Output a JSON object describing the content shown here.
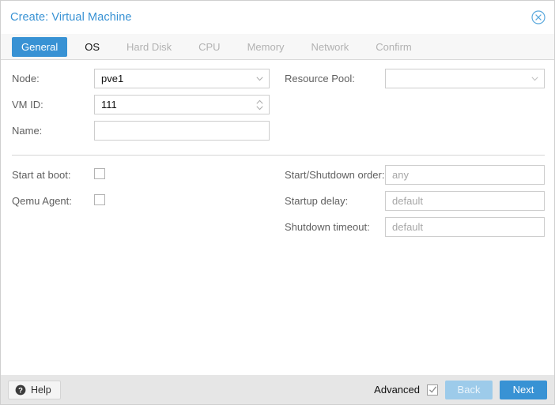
{
  "window": {
    "title": "Create: Virtual Machine",
    "close_icon": "circle-x-icon",
    "accent_color": "#3892d4",
    "disabled_accent_color": "#9dcbea"
  },
  "tabs": [
    {
      "label": "General",
      "state": "active"
    },
    {
      "label": "OS",
      "state": "enabled"
    },
    {
      "label": "Hard Disk",
      "state": "disabled"
    },
    {
      "label": "CPU",
      "state": "disabled"
    },
    {
      "label": "Memory",
      "state": "disabled"
    },
    {
      "label": "Network",
      "state": "disabled"
    },
    {
      "label": "Confirm",
      "state": "disabled"
    }
  ],
  "form": {
    "left": {
      "node": {
        "label": "Node:",
        "value": "pve1",
        "type": "select"
      },
      "vmid": {
        "label": "VM ID:",
        "value": "111",
        "type": "spinner"
      },
      "name": {
        "label": "Name:",
        "value": "",
        "placeholder": "",
        "type": "text"
      }
    },
    "right": {
      "resource_pool": {
        "label": "Resource Pool:",
        "value": "",
        "type": "select"
      }
    }
  },
  "advanced": {
    "left": {
      "start_at_boot": {
        "label": "Start at boot:",
        "checked": false
      },
      "qemu_agent": {
        "label": "Qemu Agent:",
        "checked": false
      }
    },
    "right": {
      "startup_order": {
        "label": "Start/Shutdown order:",
        "value": "",
        "placeholder": "any"
      },
      "startup_delay": {
        "label": "Startup delay:",
        "value": "",
        "placeholder": "default"
      },
      "shutdown_timeout": {
        "label": "Shutdown timeout:",
        "value": "",
        "placeholder": "default"
      }
    }
  },
  "footer": {
    "help_label": "Help",
    "help_icon": "question-circle-icon",
    "advanced_label": "Advanced",
    "advanced_checked": true,
    "advanced_check_glyph": "✓",
    "back_label": "Back",
    "back_disabled": true,
    "next_label": "Next"
  }
}
